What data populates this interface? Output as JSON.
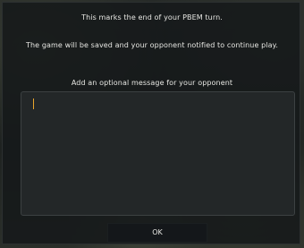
{
  "dialog": {
    "title_line": "This marks the end of your PBEM turn.",
    "info_line": "The game will be saved and your opponent notified to continue play.",
    "message_prompt": "Add an optional message for your opponent",
    "message_value": "",
    "ok_label": "OK"
  },
  "colors": {
    "caret": "#e8a52c",
    "dialog_bg": "#16191a",
    "text": "#e6e6e2"
  }
}
